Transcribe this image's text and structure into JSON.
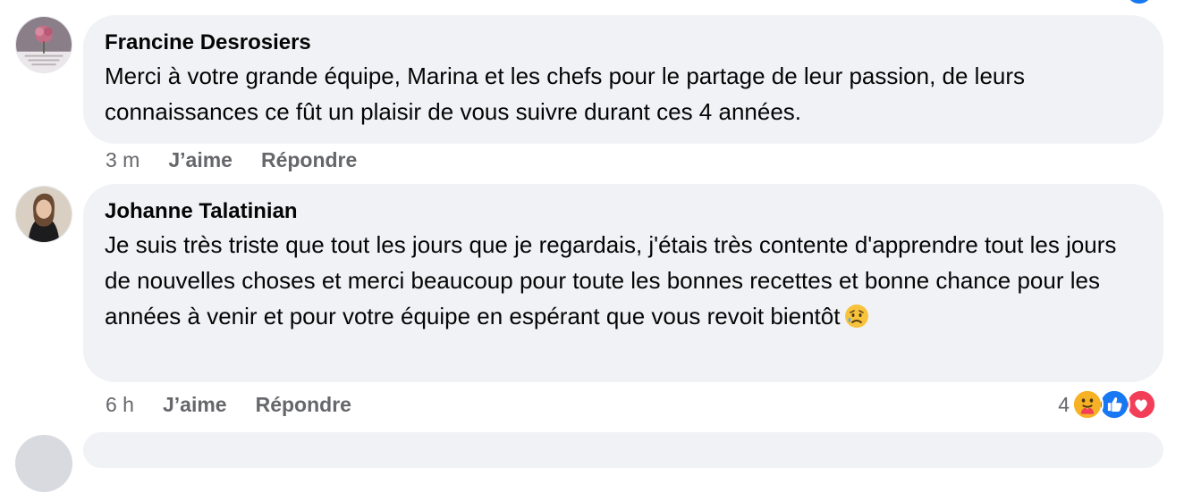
{
  "comments": [
    {
      "author": "Francine Desrosiers",
      "text": "Merci à votre grande équipe, Marina et les chefs pour le partage de leur passion, de leurs connaissances ce fût un plaisir de vous suivre durant ces 4 années.",
      "time": "3 m",
      "like_label": "J’aime",
      "reply_label": "Répondre"
    },
    {
      "author": "Johanne Talatinian",
      "text": "Je suis très triste que tout les jours que je regardais, j'étais très contente d'apprendre tout les jours de nouvelles choses et merci beaucoup pour toute les bonnes recettes et bonne chance pour les années à venir et pour votre équipe en espérant que vous revoit bientôt",
      "time": "6 h",
      "like_label": "J’aime",
      "reply_label": "Répondre",
      "reactions": {
        "count": "4",
        "icons": [
          "care-reaction-icon",
          "like-reaction-icon",
          "love-reaction-icon"
        ]
      }
    }
  ],
  "colors": {
    "bubble_bg": "#f0f2f5",
    "meta_text": "#65676b",
    "like_blue": "#1877f2",
    "love_red": "#f33e58",
    "care_yellow": "#f7b125"
  }
}
